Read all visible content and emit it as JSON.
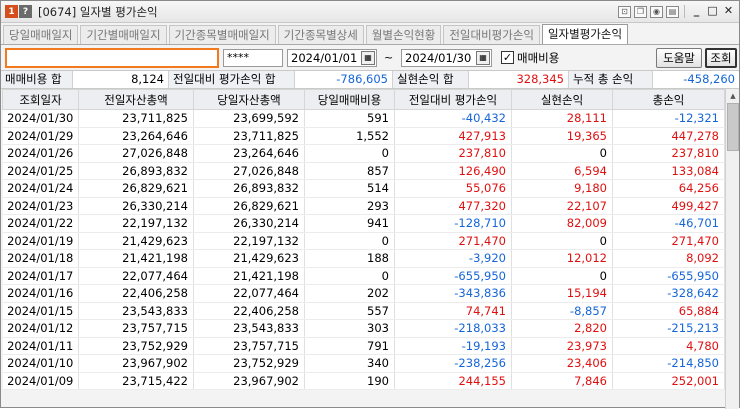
{
  "window": {
    "badge_one": "1",
    "badge_help": "?",
    "title": "[0674] 일자별 평가손익"
  },
  "tabs": [
    {
      "label": "당일매매일지",
      "active": false
    },
    {
      "label": "기간별매매일지",
      "active": false
    },
    {
      "label": "기간종목별매매일지",
      "active": false
    },
    {
      "label": "기간종목별상세",
      "active": false
    },
    {
      "label": "월별손익현황",
      "active": false
    },
    {
      "label": "전일대비평가손익",
      "active": false
    },
    {
      "label": "일자별평가손익",
      "active": true
    }
  ],
  "controls": {
    "account_value": "",
    "password_mask": "****",
    "date_from": "2024/01/01",
    "date_sep": "~",
    "date_to": "2024/01/30",
    "fee_checkbox_checked": true,
    "fee_checkbox_label": "매매비용",
    "help_button": "도움말",
    "query_button": "조회"
  },
  "summary": {
    "fee_label": "매매비용 합",
    "fee_value": "8,124",
    "eval_label": "전일대비 평가손익 합",
    "eval_value": "-786,605",
    "realized_label": "실현손익 합",
    "realized_value": "328,345",
    "total_label": "누적 총 손익",
    "total_value": "-458,260"
  },
  "table": {
    "headers": [
      "조회일자",
      "전일자산총액",
      "당일자산총액",
      "당일매매비용",
      "전일대비 평가손익",
      "실현손익",
      "총손익"
    ],
    "rows": [
      [
        "2024/01/30",
        "23,711,825",
        "23,699,592",
        "591",
        "-40,432",
        "28,111",
        "-12,321"
      ],
      [
        "2024/01/29",
        "23,264,646",
        "23,711,825",
        "1,552",
        "427,913",
        "19,365",
        "447,278"
      ],
      [
        "2024/01/26",
        "27,026,848",
        "23,264,646",
        "0",
        "237,810",
        "0",
        "237,810"
      ],
      [
        "2024/01/25",
        "26,893,832",
        "27,026,848",
        "857",
        "126,490",
        "6,594",
        "133,084"
      ],
      [
        "2024/01/24",
        "26,829,621",
        "26,893,832",
        "514",
        "55,076",
        "9,180",
        "64,256"
      ],
      [
        "2024/01/23",
        "26,330,214",
        "26,829,621",
        "293",
        "477,320",
        "22,107",
        "499,427"
      ],
      [
        "2024/01/22",
        "22,197,132",
        "26,330,214",
        "941",
        "-128,710",
        "82,009",
        "-46,701"
      ],
      [
        "2024/01/19",
        "21,429,623",
        "22,197,132",
        "0",
        "271,470",
        "0",
        "271,470"
      ],
      [
        "2024/01/18",
        "21,421,198",
        "21,429,623",
        "188",
        "-3,920",
        "12,012",
        "8,092"
      ],
      [
        "2024/01/17",
        "22,077,464",
        "21,421,198",
        "0",
        "-655,950",
        "0",
        "-655,950"
      ],
      [
        "2024/01/16",
        "22,406,258",
        "22,077,464",
        "202",
        "-343,836",
        "15,194",
        "-328,642"
      ],
      [
        "2024/01/15",
        "23,543,833",
        "22,406,258",
        "557",
        "74,741",
        "-8,857",
        "65,884"
      ],
      [
        "2024/01/12",
        "23,757,715",
        "23,543,833",
        "303",
        "-218,033",
        "2,820",
        "-215,213"
      ],
      [
        "2024/01/11",
        "23,752,929",
        "23,757,715",
        "791",
        "-19,193",
        "23,973",
        "4,780"
      ],
      [
        "2024/01/10",
        "23,967,902",
        "23,752,929",
        "340",
        "-238,256",
        "23,406",
        "-214,850"
      ],
      [
        "2024/01/09",
        "23,715,422",
        "23,967,902",
        "190",
        "244,155",
        "7,846",
        "252,001"
      ]
    ]
  },
  "colors": {
    "negative": "#1565d8",
    "positive": "#e01010",
    "account_highlight": "#f07a1d"
  }
}
